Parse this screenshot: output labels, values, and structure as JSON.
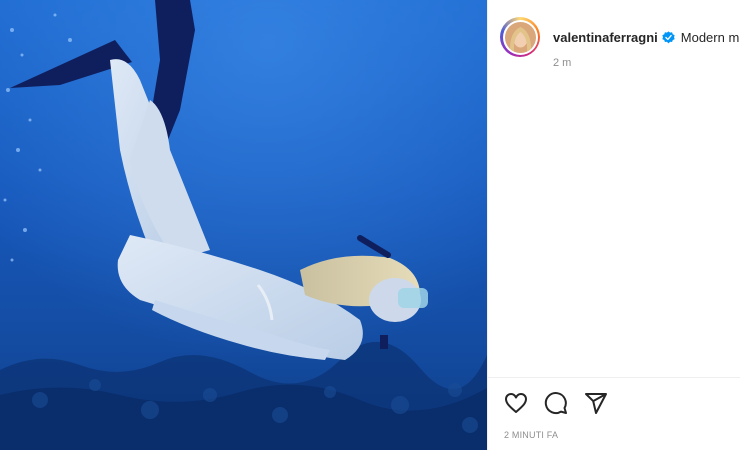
{
  "post": {
    "username": "valentinaferragni",
    "caption": "Modern m",
    "relative_time": "2 m",
    "timestamp": "2 MINUTI FA",
    "verified": true
  },
  "media": {
    "description_icon": "underwater-photo",
    "colors": {
      "water_top": "#1f6fd1",
      "water_mid": "#1552b3",
      "water_deep": "#0b3a8a",
      "fins": "#0f1f5e"
    }
  },
  "actions": [
    {
      "name": "like",
      "icon": "heart-icon"
    },
    {
      "name": "comment",
      "icon": "comment-icon"
    },
    {
      "name": "share",
      "icon": "paper-plane-icon"
    }
  ],
  "colors": {
    "verified_blue": "#0095f6",
    "text_primary": "#262626",
    "text_secondary": "#8e8e8e"
  }
}
